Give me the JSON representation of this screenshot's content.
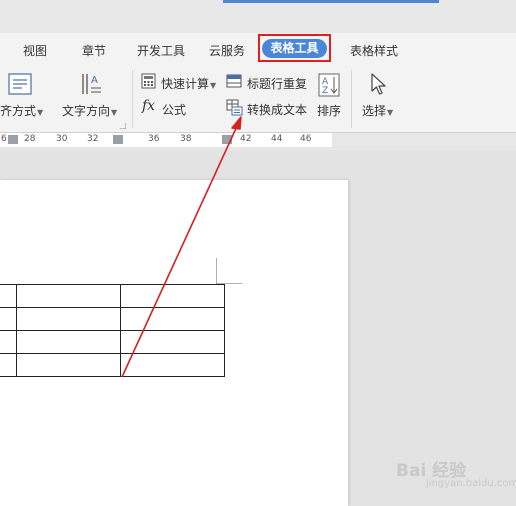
{
  "menu_tabs": [
    {
      "label": "视图"
    },
    {
      "label": "章节"
    },
    {
      "label": "开发工具"
    },
    {
      "label": "云服务"
    },
    {
      "label": "表格工具"
    },
    {
      "label": "表格样式"
    }
  ],
  "active_tab": "表格工具",
  "ribbon": {
    "align": "齐方式",
    "text_direction": "文字方向",
    "quick_calc": "快速计算",
    "formula": "公式",
    "header_repeat": "标题行重复",
    "convert_to_text": "转换成文本",
    "sort": "排序",
    "select": "选择"
  },
  "ruler_labels": [
    "6",
    "28",
    "30",
    "32",
    "36",
    "38",
    "42",
    "44",
    "46"
  ],
  "table": {
    "rows": 4,
    "cols": 3
  },
  "watermark": {
    "text": "Bai 经验",
    "sub": "jingyan.baidu.com"
  },
  "colors": {
    "accent": "#4a87d6",
    "highlight_box": "#e02020",
    "arrow": "#d42020"
  }
}
